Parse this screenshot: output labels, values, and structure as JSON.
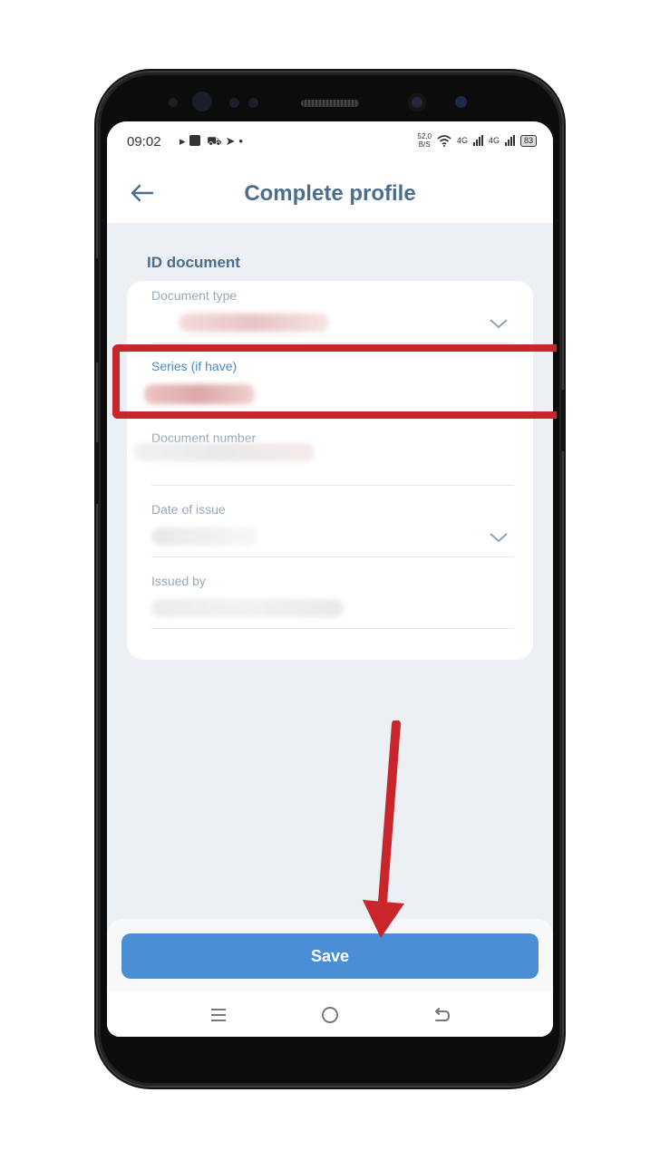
{
  "status_bar": {
    "time": "09:02",
    "net_speed_value": "52,0",
    "net_speed_unit": "B/S",
    "signal_1": "4G",
    "signal_2": "4G",
    "battery": "83"
  },
  "header": {
    "title": "Complete profile"
  },
  "section": {
    "title": "ID document"
  },
  "form": {
    "fields": [
      {
        "label": "Document type"
      },
      {
        "label": "Series (if have)"
      },
      {
        "label": "Document number"
      },
      {
        "label": "Date of issue"
      },
      {
        "label": "Issued by"
      }
    ]
  },
  "actions": {
    "save_label": "Save"
  },
  "colors": {
    "accent": "#4a8fd5",
    "title": "#4b6e8e",
    "annotation": "#c9262b"
  }
}
